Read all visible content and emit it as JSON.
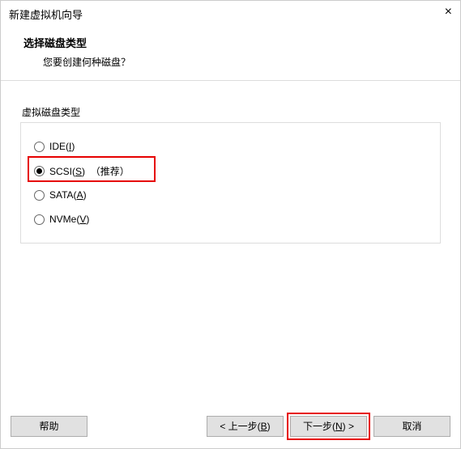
{
  "window": {
    "title": "新建虚拟机向导"
  },
  "header": {
    "title": "选择磁盘类型",
    "subtitle": "您要创建何种磁盘？"
  },
  "fieldset": {
    "label": "虚拟磁盘类型",
    "options": {
      "ide": {
        "prefix": "IDE(",
        "hotkey": "I",
        "suffix": ")"
      },
      "scsi": {
        "prefix": "SCSI(",
        "hotkey": "S",
        "suffix": ")",
        "extra": "（推荐）"
      },
      "sata": {
        "prefix": "SATA(",
        "hotkey": "A",
        "suffix": ")"
      },
      "nvme": {
        "prefix": "NVMe(",
        "hotkey": "V",
        "suffix": ")"
      }
    },
    "selected": "scsi"
  },
  "buttons": {
    "help": "帮助",
    "back_prefix": "< 上一步(",
    "back_hotkey": "B",
    "back_suffix": ")",
    "next_prefix": "下一步(",
    "next_hotkey": "N",
    "next_suffix": ") >",
    "cancel": "取消"
  }
}
